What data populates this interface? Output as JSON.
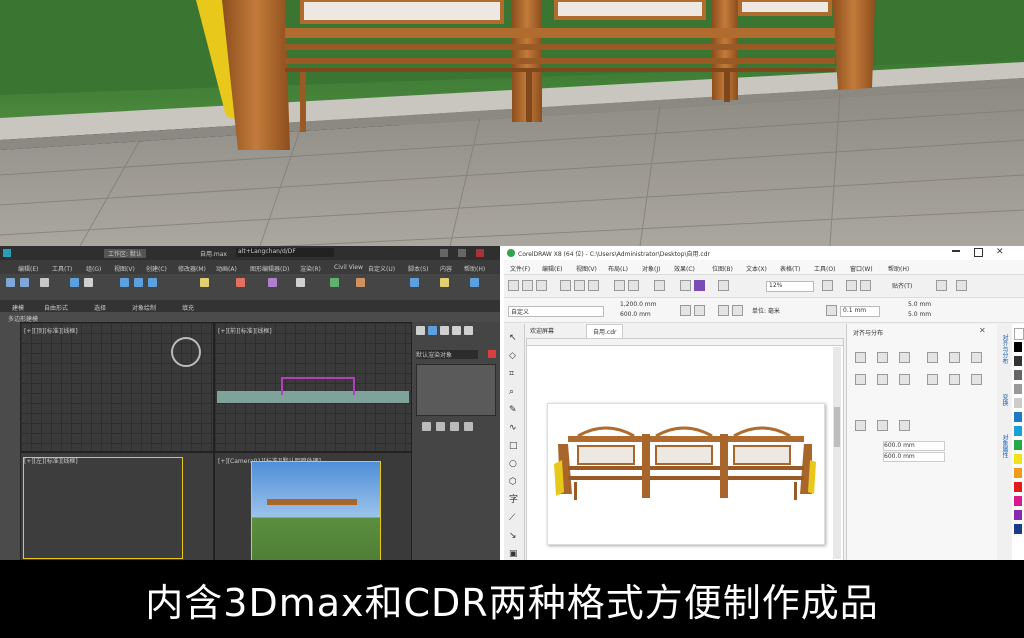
{
  "caption": "内含3Dmax和CDR两种格式方便制作成品",
  "max_window": {
    "tabs": [
      "工作区: 默认",
      "自用.max"
    ],
    "search_value": "alt+Langchan/d/DF",
    "menu_items": [
      "编辑(E)",
      "工具(T)",
      "组(G)",
      "视图(V)",
      "创建(C)",
      "修改器(M)",
      "动画(A)",
      "图形编辑器(D)",
      "渲染(R)",
      "Civil View",
      "自定义(U)",
      "脚本(S)",
      "内容",
      "帮助(H)"
    ],
    "ribbon_tabs": [
      "建模",
      "自由形式",
      "选择",
      "对象绘制",
      "填充"
    ],
    "ribbon_sub": "多边形建模",
    "viewport_labels": [
      "[+][顶][标准][线框]",
      "[+][前][标准][线框]",
      "[+][左][标准][线框]",
      "[+][Camera01][标准][默认明暗处理]"
    ],
    "cmd_panel_field": "默认渲染对象"
  },
  "cdr_window": {
    "title": "CorelDRAW X8 (64 位) - C:\\Users\\Administrator\\Desktop\\自用.cdr",
    "menu_items": [
      "文件(F)",
      "编辑(E)",
      "视图(V)",
      "布局(L)",
      "对象(J)",
      "效果(C)",
      "位图(B)",
      "文本(X)",
      "表格(T)",
      "工具(O)",
      "窗口(W)",
      "帮助(H)"
    ],
    "zoom": "12%",
    "snap_label": "贴齐(T)",
    "preset": "自定义",
    "width_value": "1,200.0 mm",
    "height_value": "600.0 mm",
    "unit_label": "单位: 毫米",
    "nudge_value": "0.1 mm",
    "dup_x": "5.0 mm",
    "dup_y": "5.0 mm",
    "doc_tabs": [
      "欢迎屏幕",
      "自用.cdr"
    ],
    "docker_title": "对齐与分布",
    "docker_size_w": "600.0 mm",
    "docker_size_h": "600.0 mm",
    "side_tabs": [
      "对齐与分布",
      "变换",
      "对象属性"
    ]
  },
  "colors": {
    "wood": "#a8652c",
    "accent_yellow": "#e8c81a",
    "grass": "#3f7a36",
    "pavement": "#9d9a93"
  }
}
